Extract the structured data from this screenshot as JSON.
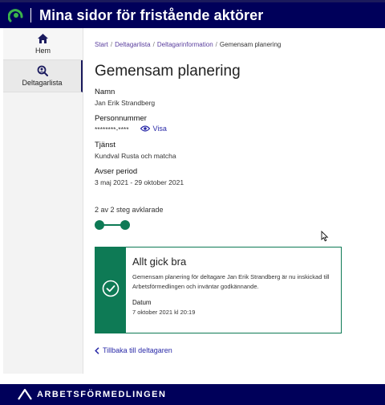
{
  "header": {
    "title": "Mina sidor för fristående aktörer",
    "logo_icon": "arbetsformedlingen-logo-icon"
  },
  "sidebar": {
    "items": [
      {
        "label": "Hem",
        "icon": "home-icon",
        "active": false
      },
      {
        "label": "Deltagarlista",
        "icon": "search-person-icon",
        "active": true
      }
    ]
  },
  "breadcrumb": {
    "items": [
      "Start",
      "Deltagarlista",
      "Deltagarinformation",
      "Gemensam planering"
    ],
    "separator": "/"
  },
  "main": {
    "title": "Gemensam planering",
    "fields": {
      "namn_label": "Namn",
      "namn_value": "Jan Erik Strandberg",
      "personnummer_label": "Personnummer",
      "personnummer_value": "********-****",
      "visa_label": "Visa",
      "tjanst_label": "Tjänst",
      "tjanst_value": "Kundval Rusta och matcha",
      "period_label": "Avser period",
      "period_value": "3 maj 2021 - 29 oktober 2021"
    },
    "steps": {
      "text": "2 av 2 steg avklarade",
      "completed": 2,
      "total": 2
    },
    "card": {
      "title": "Allt gick bra",
      "body": "Gemensam planering för deltagare Jan Erik Strandberg är nu inskickad till Arbetsförmedlingen och inväntar godkännande.",
      "date_label": "Datum",
      "date_value": "7 oktober 2021 kl 20:19"
    },
    "back_link": "Tillbaka till deltagaren"
  },
  "footer": {
    "brand": "ARBETSFÖRMEDLINGEN"
  },
  "colors": {
    "navy": "#00005a",
    "green": "#0e7a55",
    "link": "#2a2aa8",
    "breadcrumb_link": "#5a3e9e"
  }
}
